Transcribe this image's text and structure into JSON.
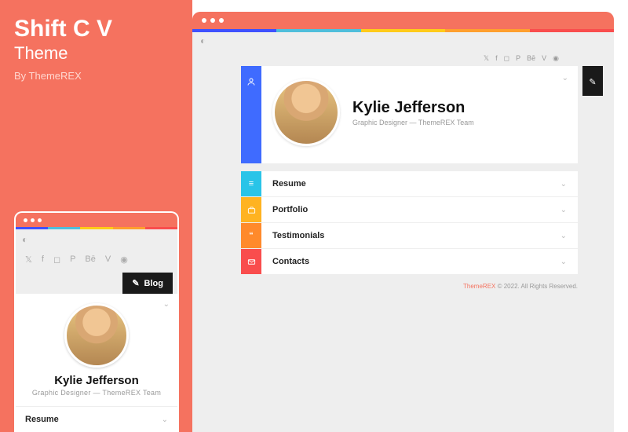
{
  "product": {
    "title": "Shift C V",
    "subtitle": "Theme",
    "author": "By ThemeREX"
  },
  "profile": {
    "name": "Kylie Jefferson",
    "role": "Graphic Designer — ThemeREX Team"
  },
  "blog_label": "Blog",
  "nav": [
    {
      "label": "Resume",
      "color": "#29c4e8",
      "icon": "menu"
    },
    {
      "label": "Portfolio",
      "color": "#ffb321",
      "icon": "briefcase"
    },
    {
      "label": "Testimonials",
      "color": "#ff8a2b",
      "icon": "quote"
    },
    {
      "label": "Contacts",
      "color": "#f94d4d",
      "icon": "mail"
    }
  ],
  "socials": [
    "twitter",
    "facebook",
    "instagram",
    "pinterest",
    "behance",
    "vimeo",
    "dribbble"
  ],
  "footer": {
    "brand": "ThemeREX",
    "rest": " © 2022. All Rights Reserved."
  },
  "mobile_nav_first": "Resume"
}
